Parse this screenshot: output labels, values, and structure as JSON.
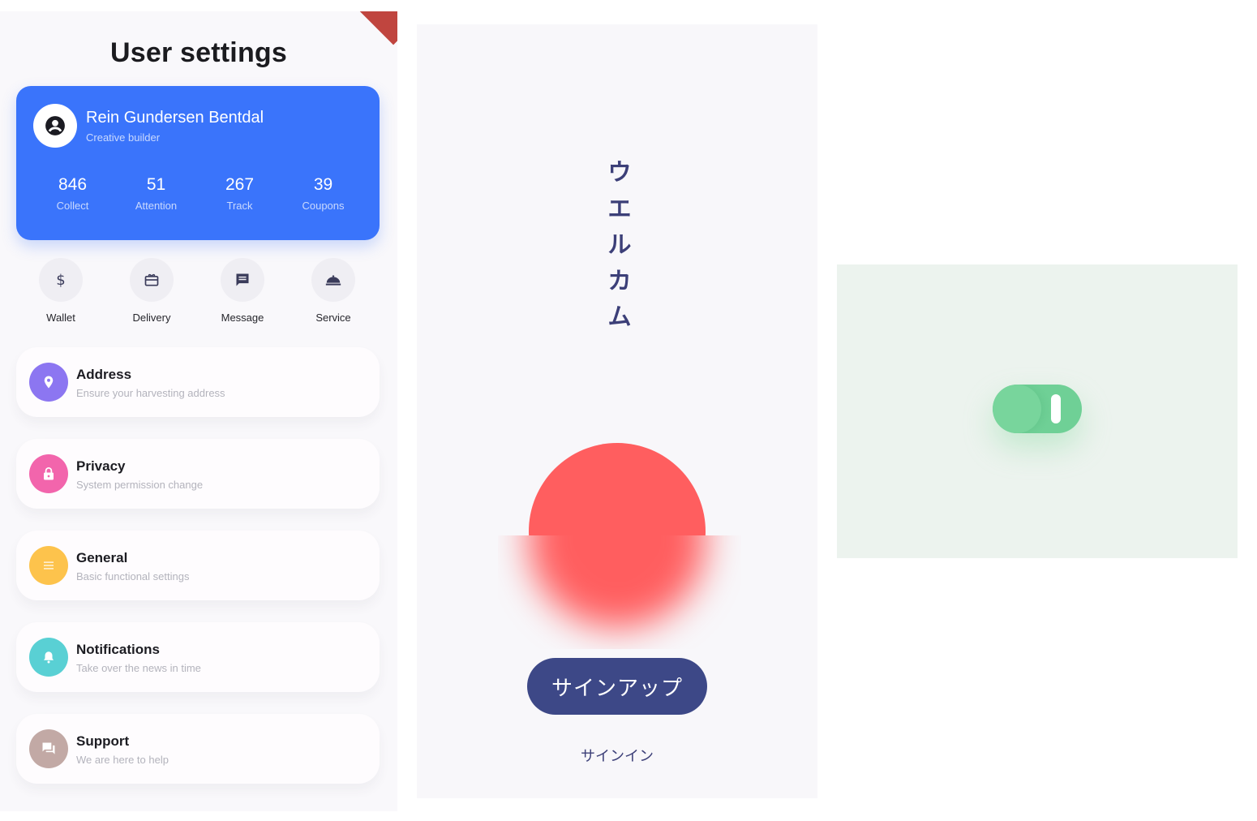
{
  "settings": {
    "title": "User settings",
    "profile": {
      "name": "Rein Gundersen Bentdal",
      "role": "Creative builder",
      "stats": [
        {
          "value": "846",
          "label": "Collect"
        },
        {
          "value": "51",
          "label": "Attention"
        },
        {
          "value": "267",
          "label": "Track"
        },
        {
          "value": "39",
          "label": "Coupons"
        }
      ]
    },
    "shortcuts": [
      {
        "label": "Wallet",
        "icon": "dollar-icon"
      },
      {
        "label": "Delivery",
        "icon": "gift-card-icon"
      },
      {
        "label": "Message",
        "icon": "message-icon"
      },
      {
        "label": "Service",
        "icon": "room-service-icon"
      }
    ],
    "items": [
      {
        "title": "Address",
        "subtitle": "Ensure your harvesting address",
        "icon": "location-pin-icon",
        "color": "#8c76f1"
      },
      {
        "title": "Privacy",
        "subtitle": "System permission change",
        "icon": "lock-icon",
        "color": "#f265ac"
      },
      {
        "title": "General",
        "subtitle": "Basic functional settings",
        "icon": "menu-icon",
        "color": "#fdc34c"
      },
      {
        "title": "Notifications",
        "subtitle": "Take over the news in time",
        "icon": "bell-icon",
        "color": "#59d0d4"
      },
      {
        "title": "Support",
        "subtitle": "We are here to help",
        "icon": "forum-icon",
        "color": "#c2a9a5"
      }
    ]
  },
  "welcome": {
    "characters": [
      "ウ",
      "エ",
      "ル",
      "カ",
      "ム"
    ],
    "signup_label": "サインアップ",
    "signin_label": "サインイン",
    "accent_color": "#ff5e5f",
    "button_color": "#3d4887"
  },
  "toggle": {
    "state": "on",
    "color": "#6fd096"
  }
}
